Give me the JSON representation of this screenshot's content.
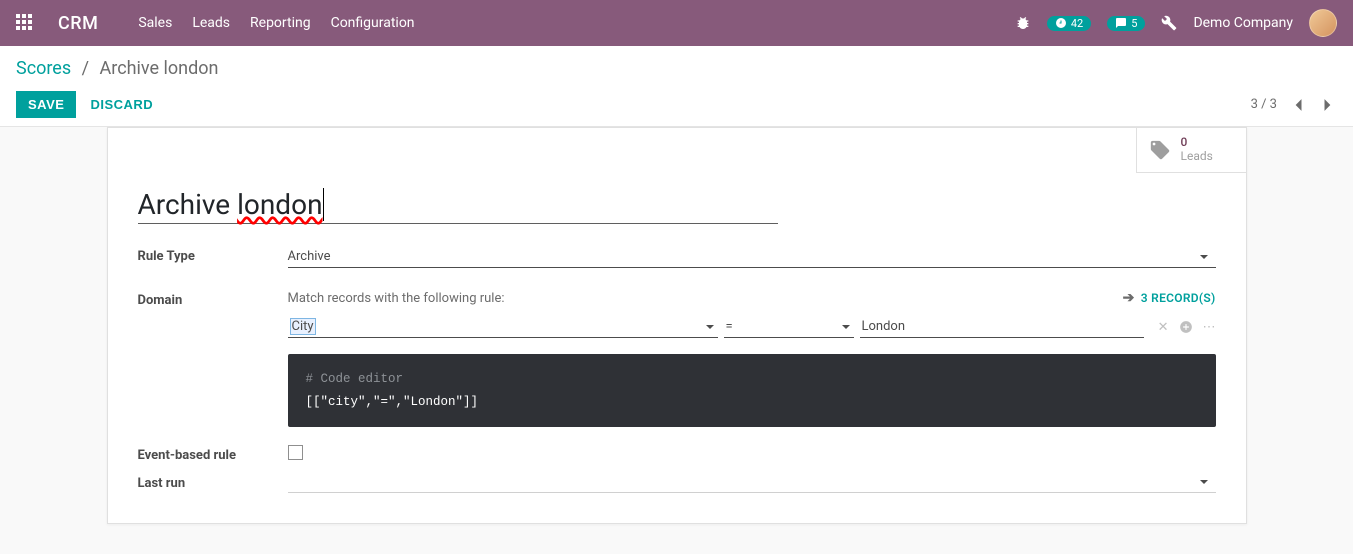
{
  "nav": {
    "brand": "CRM",
    "menu": [
      "Sales",
      "Leads",
      "Reporting",
      "Configuration"
    ],
    "badge1": "42",
    "badge2": "5",
    "company": "Demo Company"
  },
  "breadcrumb": {
    "root": "Scores",
    "current": "Archive london"
  },
  "actions": {
    "save": "SAVE",
    "discard": "DISCARD"
  },
  "pager": {
    "text": "3 / 3"
  },
  "stat": {
    "count": "0",
    "label": "Leads"
  },
  "form": {
    "title_static": "Archive ",
    "title_spell": "london",
    "labels": {
      "rule_type": "Rule Type",
      "domain": "Domain",
      "event_based": "Event-based rule",
      "last_run": "Last run"
    },
    "rule_type_value": "Archive",
    "domain_desc": "Match records with the following rule:",
    "records_link": "3 RECORD(S)",
    "domain_field": "City",
    "domain_op": "=",
    "domain_value": "London",
    "code_comment": "# Code editor",
    "code_body": "[[\"city\",\"=\",\"London\"]]"
  }
}
